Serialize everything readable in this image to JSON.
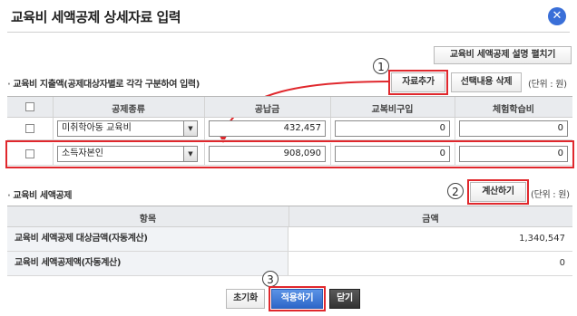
{
  "dialog": {
    "title": "교육비 세액공제 상세자료 입력",
    "close_icon": "close-icon",
    "guide_button": "교육비 세액공제 설명 펼치기"
  },
  "section1": {
    "label": "교육비 지출액(공제대상자별로 각각 구분하여 입력)",
    "add_button": "자료추가",
    "delete_button": "선택내용 삭제",
    "unit": "(단위 : 원)",
    "columns": [
      "공제종류",
      "공납금",
      "교복비구입",
      "체험학습비"
    ],
    "rows": [
      {
        "type": "미취학아동 교육비",
        "tuition": "432,457",
        "uniform": "0",
        "field_trip": "0"
      },
      {
        "type": "소득자본인",
        "tuition": "908,090",
        "uniform": "0",
        "field_trip": "0"
      }
    ]
  },
  "section2": {
    "label": "교육비 세액공제",
    "calc_button": "계산하기",
    "unit": "(단위 : 원)",
    "columns": [
      "항목",
      "금액"
    ],
    "rows": [
      {
        "label": "교육비 세액공제 대상금액(자동계산)",
        "value": "1,340,547"
      },
      {
        "label": "교육비 세액공제액(자동계산)",
        "value": "0"
      }
    ]
  },
  "footer": {
    "reset_button": "초기화",
    "apply_button": "적용하기",
    "close_button": "닫기"
  },
  "markers": [
    "1",
    "2",
    "3"
  ],
  "colors": {
    "highlight": "#e0282d",
    "accent": "#2d67c9"
  }
}
